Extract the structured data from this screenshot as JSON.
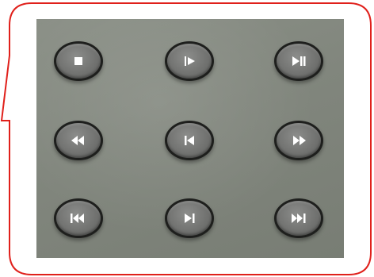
{
  "panel": {
    "buttons": [
      {
        "id": "stop",
        "name": "stop-button",
        "icon": "stop-icon"
      },
      {
        "id": "play",
        "name": "play-button",
        "icon": "play-icon"
      },
      {
        "id": "play-pause",
        "name": "play-pause-button",
        "icon": "play-pause-icon"
      },
      {
        "id": "rewind",
        "name": "rewind-button",
        "icon": "rewind-icon"
      },
      {
        "id": "step-back",
        "name": "step-back-button",
        "icon": "step-back-icon"
      },
      {
        "id": "fast-forward",
        "name": "fast-forward-button",
        "icon": "fast-forward-icon"
      },
      {
        "id": "skip-previous",
        "name": "skip-previous-button",
        "icon": "skip-previous-icon"
      },
      {
        "id": "step-forward",
        "name": "step-forward-button",
        "icon": "step-forward-icon"
      },
      {
        "id": "skip-next",
        "name": "skip-next-button",
        "icon": "skip-next-icon"
      }
    ]
  },
  "colors": {
    "callout_border": "#e0201b",
    "panel_gray": "#81867d",
    "button_face": "#727371",
    "icon": "#ffffff"
  }
}
